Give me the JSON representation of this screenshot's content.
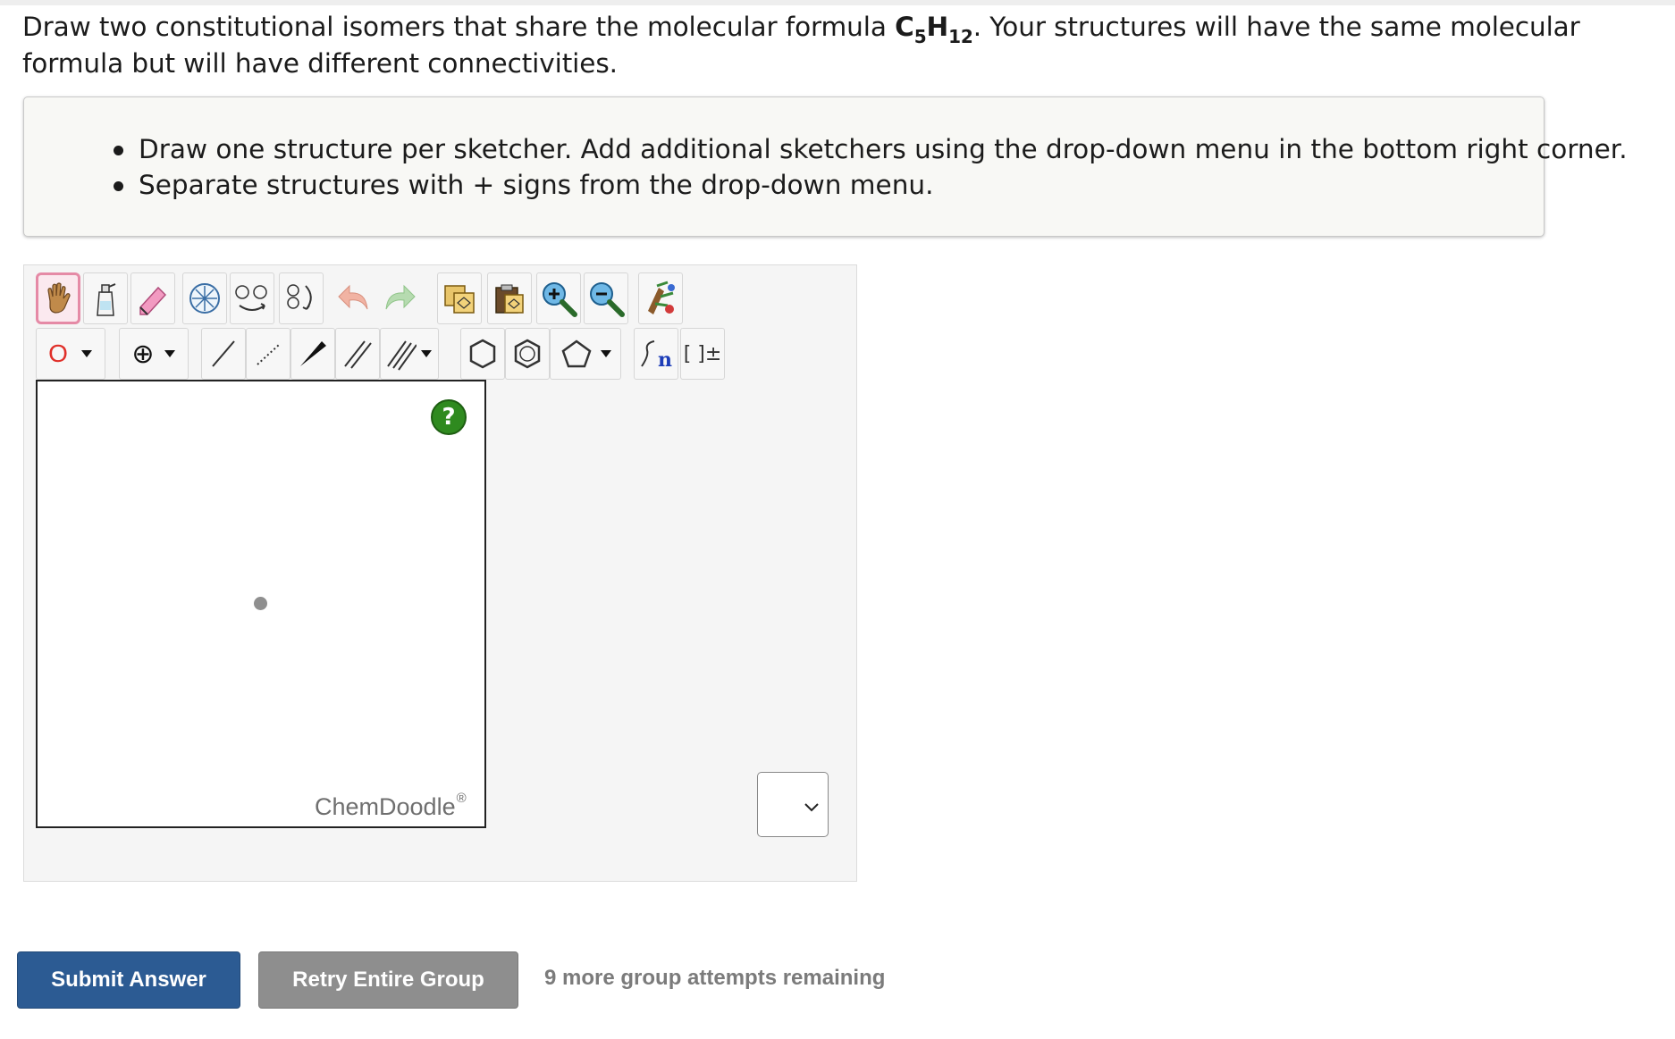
{
  "question": {
    "text_before": "Draw two constitutional isomers that share the molecular formula ",
    "formula_c": "C",
    "formula_c_sub": "5",
    "formula_h": "H",
    "formula_h_sub": "12",
    "text_after": ". Your structures will have the same molecular formula but will have different connectivities."
  },
  "instructions": [
    "Draw one structure per sketcher. Add additional sketchers using the drop-down menu in the bottom right corner.",
    "Separate structures with + signs from the drop-down menu."
  ],
  "toolbar": {
    "row1_icons": [
      "hand-icon",
      "spray-bottle-icon",
      "eraser-icon",
      "center-icon",
      "flip-icon",
      "rotate-icon",
      "undo-icon",
      "redo-icon",
      "copy-icon",
      "paste-icon",
      "zoom-in-icon",
      "zoom-out-icon",
      "clean-icon"
    ],
    "row2": {
      "atom_label": "O",
      "charge_symbol": "⊕",
      "repeat_unit_label": "n",
      "bracket_label": "[ ]±"
    },
    "selected_tool": "hand-icon"
  },
  "sketcher": {
    "brand": "ChemDoodle",
    "brand_mark": "®",
    "help_label": "?"
  },
  "buttons": {
    "submit": "Submit Answer",
    "retry": "Retry Entire Group"
  },
  "attempts_text": "9 more group attempts remaining",
  "colors": {
    "submit": "#2c5b93",
    "retry": "#8e8e8e",
    "selected_border": "#e58aa6",
    "help_green": "#2f8a1f",
    "atom_red": "#e0302a"
  }
}
